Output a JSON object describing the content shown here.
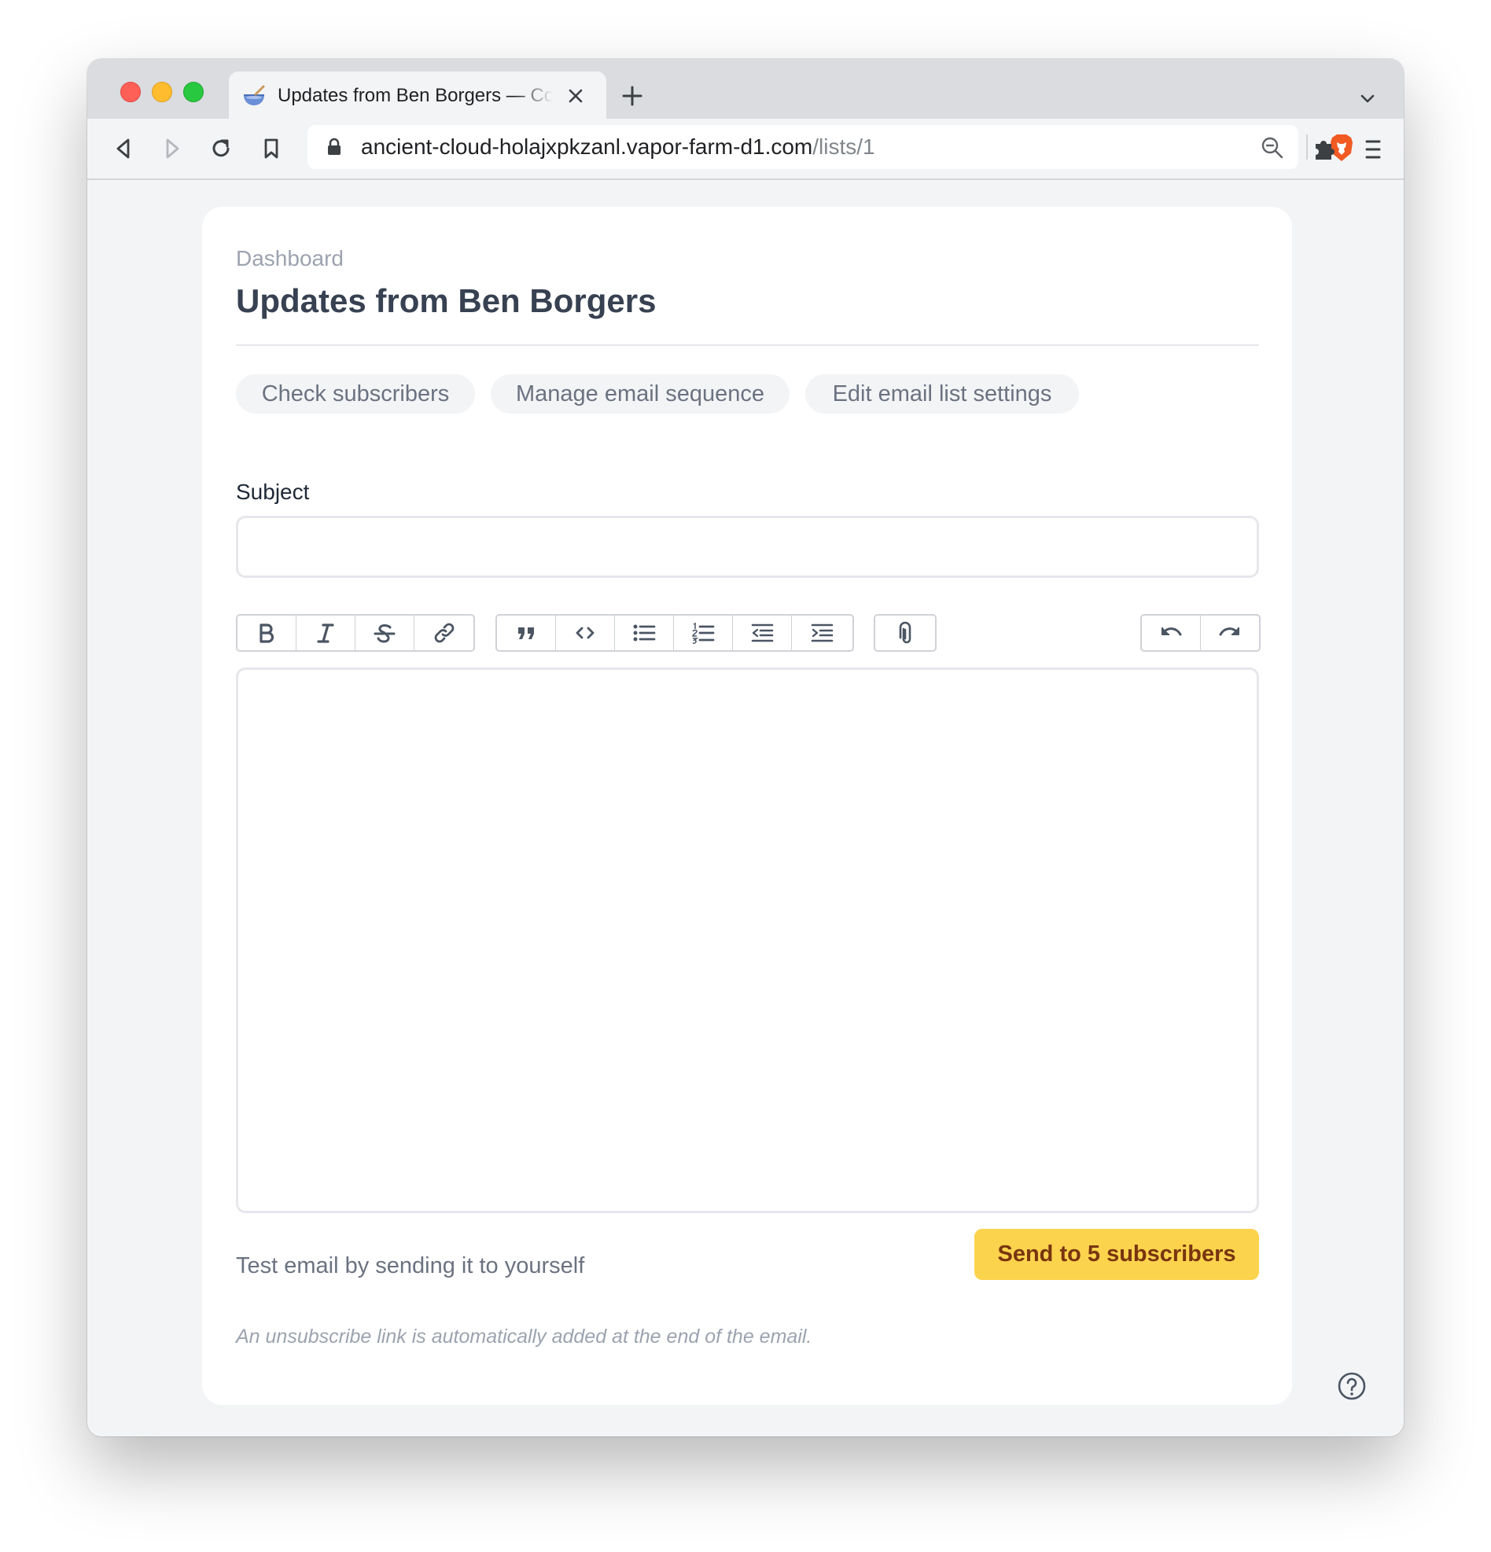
{
  "browser": {
    "tab": {
      "title": "Updates from Ben Borgers — Co",
      "favicon": "bowl-icon"
    },
    "url": {
      "host": "ancient-cloud-holajxpkzanl.vapor-farm-d1.com",
      "path": "/lists/1"
    },
    "icons": [
      "back-icon",
      "forward-icon",
      "reload-icon",
      "bookmark-icon",
      "lock-icon",
      "zoom-icon",
      "brave-shield-icon",
      "extensions-icon",
      "menu-icon",
      "chevron-down-icon",
      "new-tab-icon",
      "close-icon"
    ]
  },
  "page": {
    "breadcrumb": "Dashboard",
    "title": "Updates from Ben Borgers",
    "nav": [
      {
        "label": "Check subscribers"
      },
      {
        "label": "Manage email sequence"
      },
      {
        "label": "Edit email list settings"
      }
    ],
    "subject": {
      "label": "Subject",
      "value": "",
      "placeholder": ""
    },
    "editor_toolbar": {
      "groups": [
        [
          "bold",
          "italic",
          "strikethrough",
          "link"
        ],
        [
          "quote",
          "code",
          "bullet-list",
          "numbered-list",
          "outdent",
          "indent"
        ],
        [
          "attach"
        ],
        [
          "undo",
          "redo"
        ]
      ]
    },
    "body": {
      "value": ""
    },
    "test_email": "Test email by sending it to yourself",
    "send_button": "Send to 5 subscribers",
    "unsubscribe_note": "An unsubscribe link is automatically added at the end of the email."
  },
  "colors": {
    "accent": "#fcd34d",
    "accent_text": "#78350f",
    "heading": "#374151",
    "muted": "#9ca3af",
    "background": "#f3f4f6"
  }
}
